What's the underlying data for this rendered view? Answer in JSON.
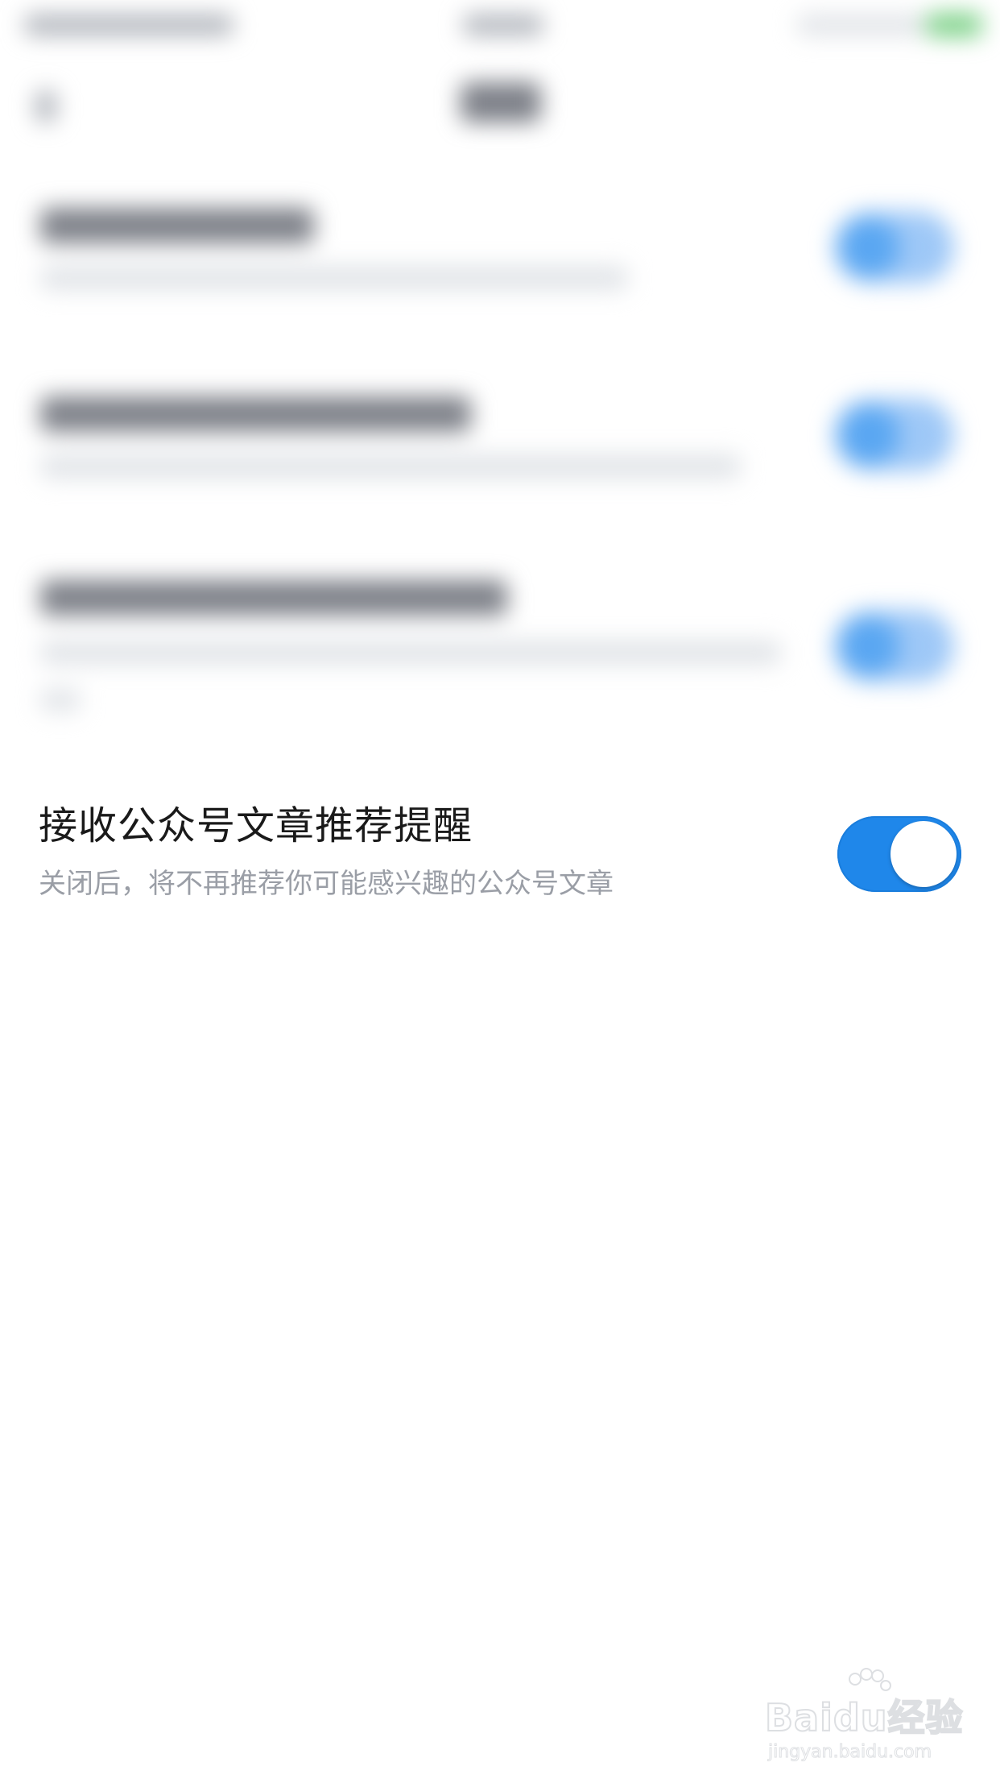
{
  "setting": {
    "title": "接收公众号文章推荐提醒",
    "description": "关闭后，将不再推荐你可能感兴趣的公众号文章",
    "toggle_on": true
  },
  "colors": {
    "toggle_on": "#1f87ea",
    "title_text": "#1a1a1a",
    "description_text": "#9a9ea6",
    "background": "#ffffff"
  },
  "watermark": {
    "main": "Baidu经验",
    "sub": "jingyan.baidu.com"
  }
}
